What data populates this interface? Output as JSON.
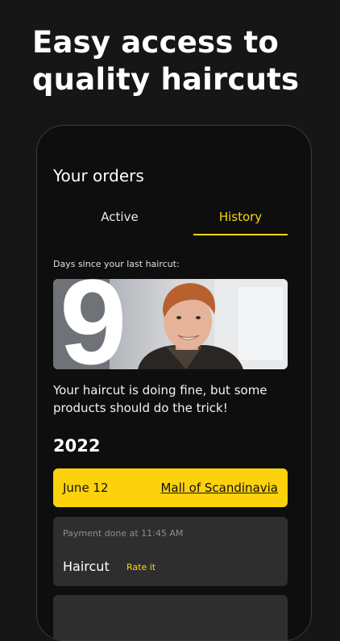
{
  "headline": "Easy access to\nquality haircuts",
  "orders": {
    "title": "Your orders",
    "tabs": [
      {
        "label": "Active",
        "selected": false
      },
      {
        "label": "History",
        "selected": true
      }
    ],
    "days_label": "Days since your last haircut:",
    "days_count": "9",
    "message": "Your haircut is doing fine, but some products should do the trick!",
    "year": "2022",
    "highlighted_order": {
      "date": "June 12",
      "location": "Mall of Scandinavia"
    },
    "order_detail": {
      "payment": "Payment done at 11:45 AM",
      "service": "Haircut",
      "rate_label": "Rate it"
    }
  },
  "colors": {
    "background": "#161616",
    "accent": "#fcd20c",
    "card": "#2e2e2e"
  }
}
